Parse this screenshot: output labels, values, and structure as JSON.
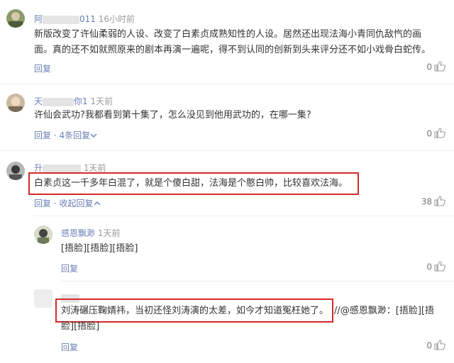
{
  "comments": [
    {
      "name_prefix": "阿",
      "name_suffix": "011",
      "time": "16小时前",
      "lines": [
        "新版改变了许仙柔弱的人设、改变了白素贞成熟知性的人设。居然还出现法海小青同仇敌忾的画",
        "面。真的还不如就照原来的剧本再演一遍呢，得不到认同的创新到头来评分还不如小戏骨白蛇传。"
      ],
      "reply_label": "回复",
      "likes": "0"
    },
    {
      "name_prefix": "天",
      "name_suffix": "你1",
      "time": "1天前",
      "lines": [
        "许仙会武功?我都看到第十集了，怎么没见到他用武功的，在哪一集?"
      ],
      "reply_label": "回复",
      "sep": "·",
      "replies_label": "4条回复",
      "likes": "0"
    },
    {
      "name_prefix": "升",
      "name_suffix": "",
      "time": "1天前",
      "lines": [
        "白素贞这一千多年白混了，就是个傻白甜，法海是个憨白帅，比较喜欢法海。"
      ],
      "reply_label": "回复",
      "sep": "·",
      "collapse_label": "收起回复",
      "likes": "38"
    }
  ],
  "replies": [
    {
      "name": "感恩飘渺",
      "time": "1天前",
      "text": "[捂脸][捂脸][捂脸]",
      "reply_label": "回复",
      "likes": "0"
    },
    {
      "name": "",
      "time": "",
      "line1": "刘涛碾压鞠婧祎，当初还怪刘涛演的太差，如今才知道冤枉她了。",
      "line1_rest": "//@感恩飘渺：[捂脸][捂",
      "line2": "脸][捂脸]",
      "reply_label": "回复",
      "likes": "0"
    }
  ],
  "icons": {
    "like": "thumbs-up-icon",
    "collapse": "chevron-up-icon"
  },
  "colors": {
    "link": "#6a7fb5",
    "highlight_box": "#d62a2a"
  }
}
